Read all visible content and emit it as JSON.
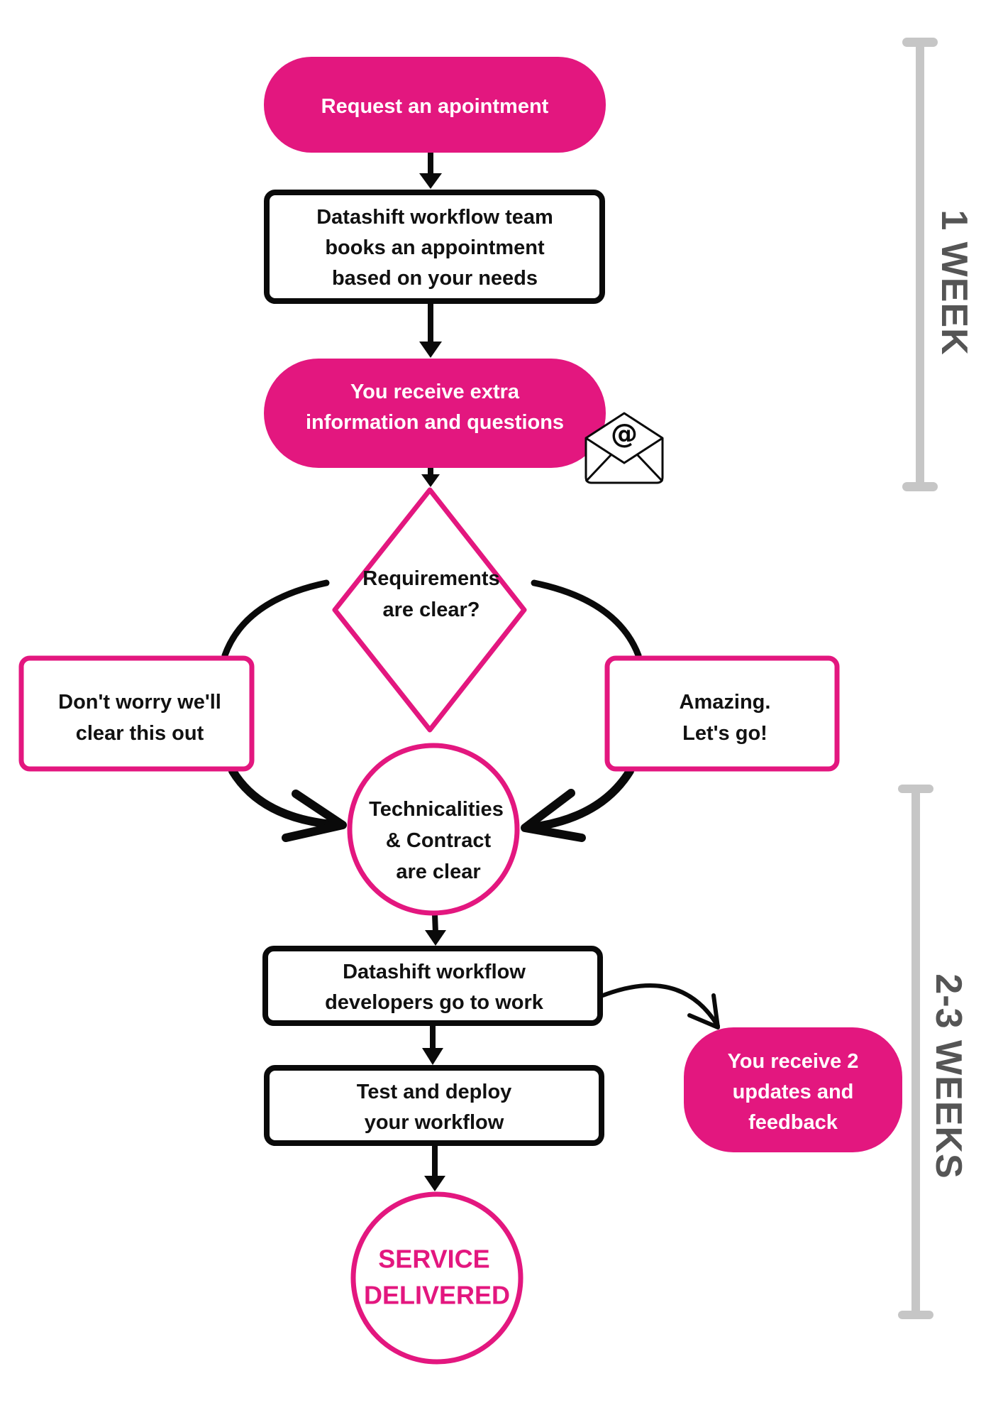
{
  "colors": {
    "accent": "#E3177F",
    "outline": "#0a0a0a",
    "timeline": "#C6C6C6",
    "timeline_text": "#555555"
  },
  "nodes": {
    "request": {
      "lines": [
        "Request an apointment"
      ]
    },
    "books": {
      "lines": [
        "Datashift workflow team",
        "books an appointment",
        "based on your needs"
      ]
    },
    "receive_info": {
      "lines": [
        "You receive extra",
        "information and questions"
      ],
      "icon": "email-at-envelope-icon"
    },
    "decision": {
      "lines": [
        "Requirements",
        "are clear?"
      ]
    },
    "no_branch": {
      "lines": [
        "Don't worry we'll",
        "clear this out"
      ]
    },
    "yes_branch": {
      "lines": [
        "Amazing.",
        "Let's go!"
      ]
    },
    "technicalities": {
      "lines": [
        "Technicalities",
        "& Contract",
        "are clear"
      ]
    },
    "developers": {
      "lines": [
        "Datashift workflow",
        "developers go to work"
      ]
    },
    "updates": {
      "lines": [
        "You receive 2",
        "updates and",
        "feedback"
      ]
    },
    "test_deploy": {
      "lines": [
        "Test and deploy",
        "your workflow"
      ]
    },
    "delivered": {
      "lines": [
        "SERVICE",
        "DELIVERED"
      ]
    }
  },
  "timeline": [
    {
      "label": "1 WEEK"
    },
    {
      "label": "2-3 WEEKS"
    }
  ]
}
